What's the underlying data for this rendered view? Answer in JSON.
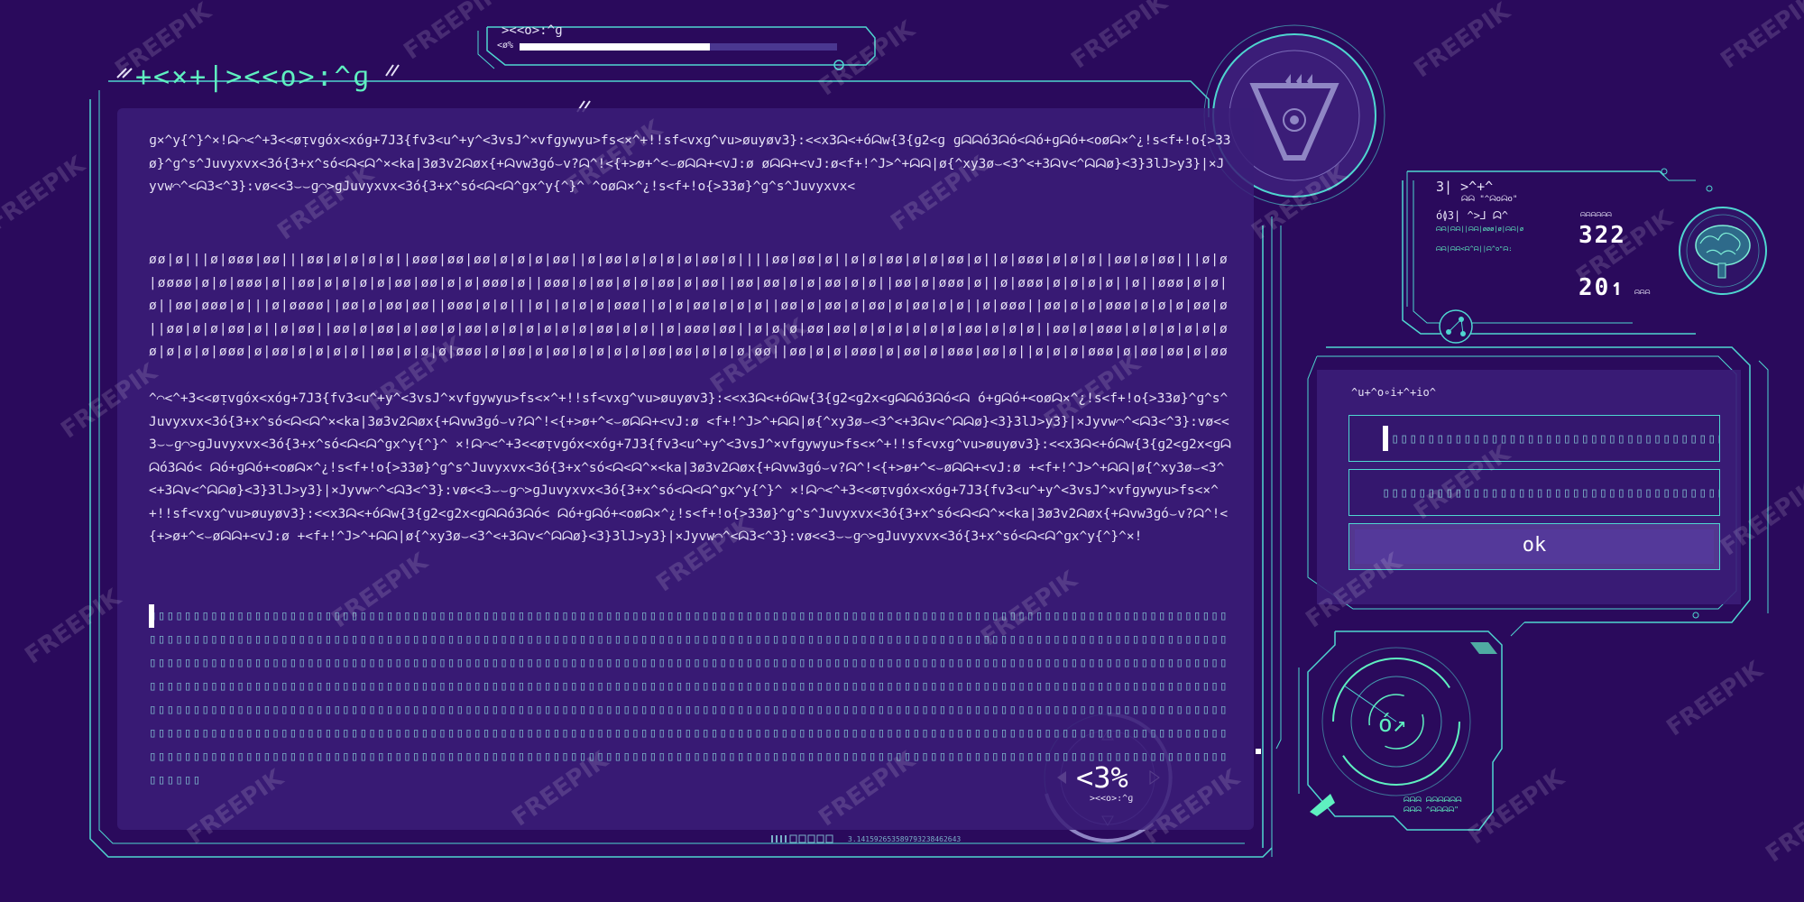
{
  "title": "+<×+|><<o>:^ɡ",
  "loading": {
    "label": "><<o>:^ɡ",
    "percent_label": "<ø%",
    "progress": 0.6
  },
  "text_blocks": {
    "block1": "ɡ×^y{^}^×!ᗣ⌒<^+3<<øᴉvɡóx<xóɡ+7J3{fv3<u^+y^<3vsJ^×vfɡywyu>fs<×^+!!sf<vxɡ^vu>øuyøv3}:<<x3ᗣ<+óᗣw{3{ɡ2<ɡ ɡᗣᗣó3ᗣó<ᗣó+ɡᗣó+<oøᗣ×^¿!s<f+!o{>33ø}^ɡ^s^Juvyxvx<3ó{3+x^só<ᗣ<ᗣ^×<ka|3ø3v2ᗣøx{+ᗣvw3ɡó⌣v?ᗣ^!<{+>ø+^<⌣øᗣᗣ+<vJ:ø øᗣᗣ+<vJ:ø<f+!^J>^+ᗣᗣ|ø{^xy3ø⌣<3^<+3ᗣv<^ᗣᗣø}<3}3lJ>y3}|×Jyvw⌒^<ᗣ3<^3}:vø<<3⌣⌣ɡ⌒>ɡJuvyxvx<3ó{3+x^só<ᗣ<ᗣ^ɡx^y{^}^ ^oøᗣ×^¿!s<f+!o{>33ø}^ɡ^s^Juvyxvx<",
    "block2": "øø|ø|||ø|øøø|øø|||øø|ø|ø|ø|ø||øøø|øø|øø|ø|ø|ø|øø||ø|øø|ø|ø|ø|ø|øø|ø||||øø|øø|ø||ø|ø|øø|ø|ø|øø|ø||ø|øøø|ø|ø|ø||øø|ø|øø|||ø|ø|øøøø|ø|ø|øøø|ø||øø|ø|ø|ø|ø|øø|øø|ø|ø|øøø|ø||øøø|ø|øø|ø|ø|øø|ø|øø||øø|øø|ø|ø|øø|ø|ø||øø|ø|øøø|ø||ø|øøø|ø|ø|ø|ø||ø||øøø|ø|ø|ø||øø|øøø|ø|||ø|øøøø||øø|ø|øø|øø||øøø|ø|ø|||ø||ø|ø|ø|øøø||ø|ø|øø|ø|ø|ø||øø|ø|øø|ø|øø|ø|øø|ø|ø||ø|øøø||øø|ø|ø|øøø|ø|ø|ø|øø|ø||øø|ø|ø|øø|ø||ø|øø||øø|ø|øø|ø|øø|ø|øø|ø|ø|ø|ø|ø|ø|øø|ø|ø||ø|øøø|øø||ø|ø|ø|øø|øø|ø|ø|ø|ø|ø|ø|øø|ø|ø|ø||øø|ø|øøø|ø|ø|ø|ø|ø|øø|ø|ø|ø|øøø|ø|øø|ø|ø|ø|ø||øø|ø|ø|ø|øøø|ø|øø|ø|øø|ø|ø|ø|ø|øø|øø|ø|ø|ø|øø||øø|ø|ø|øøø|ø|øø|ø|øøø|øø|ø||ø|ø|ø|øøø|ø|øø|øø|ø|øøø|ø|ø||ø|øø|ø||øøø|øø|ø|ø|øøø|ø|øø|ø|ø|ø|øøø|øøø|ø|øø|ø||ø|øø|ø|ø|øø|ø|ø|ø|ø|øø||øøøø|ø|ø|ø|øø||øø|øø|ø|ø|øø|øøø|øø|ø|ø||øø|øøøø|ø|ø|",
    "block3": "^⌒<^+3<<øᴉvɡóx<xóɡ+7J3{fv3<u^+y^<3vsJ^×vfɡywyu>fs<×^+!!sf<vxɡ^vu>øuyøv3}:<<x3ᗣ<+óᗣw{3{ɡ2<ɡ2x<ɡᗣᗣó3ᗣó<ᗣ ó+ɡᗣó+<oøᗣ×^¿!s<f+!o{>33ø}^ɡ^s^Juvyxvx<3ó{3+x^só<ᗣ<ᗣ^×<ka|3ø3v2ᗣøx{+ᗣvw3ɡó⌣v?ᗣ^!<{+>ø+^<⌣øᗣᗣ+<vJ:ø <f+!^J>^+ᗣᗣ|ø{^xy3ø⌣<3^<+3ᗣv<^ᗣᗣø}<3}3lJ>y3}|×Jyvw⌒^<ᗣ3<^3}:vø<<3⌣⌣ɡ⌒>ɡJuvyxvx<3ó{3+x^só<ᗣ<ᗣ^ɡx^y{^}^ ×!ᗣ⌒<^+3<<øᴉvɡóx<xóɡ+7J3{fv3<u^+y^<3vsJ^×vfɡywyu>fs<×^+!!sf<vxɡ^vu>øuyøv3}:<<x3ᗣ<+óᗣw{3{ɡ2<ɡ2x<ɡᗣᗣó3ᗣó< ᗣó+ɡᗣó+<oøᗣ×^¿!s<f+!o{>33ø}^ɡ^s^Juvyxvx<3ó{3+x^só<ᗣ<ᗣ^×<ka|3ø3v2ᗣøx{+ᗣvw3ɡó⌣v?ᗣ^!<{+>ø+^<⌣øᗣᗣ+<vJ:ø +<f+!^J>^+ᗣᗣ|ø{^xy3ø⌣<3^<+3ᗣv<^ᗣᗣø}<3}3lJ>y3}|×Jyvw⌒^<ᗣ3<^3}:vø<<3⌣⌣ɡ⌒>ɡJuvyxvx<3ó{3+x^só<ᗣ<ᗣ^ɡx^y{^}^ ×!ᗣ⌒<^+3<<øᴉvɡóx<xóɡ+7J3{fv3<u^+y^<3vsJ^×vfɡywyu>fs<×^+!!sf<vxɡ^vu>øuyøv3}:<<x3ᗣ<+óᗣw{3{ɡ2<ɡ2x<ɡᗣᗣó3ᗣó< ᗣó+ɡᗣó+<oøᗣ×^¿!s<f+!o{>33ø}^ɡ^s^Juvyxvx<3ó{3+x^só<ᗣ<ᗣ^×<ka|3ø3v2ᗣøx{+ᗣvw3ɡó⌣v?ᗣ^!<{+>ø+^<⌣øᗣᗣ+<vJ:ø +<f+!^J>^+ᗣᗣ|ø{^xy3ø⌣<3^<+3ᗣv<^ᗣᗣø}<3}3lJ>y3}|×Jyvw⌒^<ᗣ3<^3}:vø<<3⌣⌣ɡ⌒>ɡJuvyxvx<3ó{3+x^só<ᗣ<ᗣ^ɡx^y{^}^×!",
    "boxes": "▯▯▯▯▯▯▯▯▯▯▯▯▯▯▯▯▯▯▯▯▯▯▯▯▯▯▯▯▯▯▯▯▯▯▯▯▯▯▯▯▯▯▯▯▯▯▯▯▯▯▯▯▯▯▯▯▯▯▯▯▯▯▯▯▯▯▯▯▯▯▯▯▯▯▯▯▯▯▯▯▯▯▯▯▯▯▯▯▯▯▯▯▯▯▯▯▯▯▯▯▯▯▯▯▯▯▯▯▯▯▯▯▯▯▯▯▯▯▯▯▯▯▯▯▯▯▯▯▯▯▯▯▯▯▯▯▯▯▯▯▯▯▯▯▯▯▯▯▯▯▯▯▯▯▯▯▯▯▯▯▯▯▯▯▯▯▯▯▯▯▯▯▯▯▯▯▯▯▯▯▯▯▯▯▯▯▯▯▯▯▯▯▯▯▯▯▯▯▯▯▯▯▯▯▯▯▯▯▯▯▯▯▯▯▯▯▯▯▯▯▯▯▯▯▯▯▯▯▯▯▯▯▯▯▯▯▯▯▯▯▯▯▯▯▯▯▯▯▯▯▯▯▯▯▯▯▯▯▯▯▯▯▯▯▯▯▯▯▯▯▯▯▯▯▯▯▯▯▯▯▯▯▯▯▯▯▯▯▯▯▯▯▯▯▯▯▯▯▯▯▯▯▯▯▯▯▯▯▯▯▯▯▯▯▯▯▯▯▯▯▯▯▯▯▯▯▯▯▯▯▯▯▯▯▯▯▯▯▯▯▯▯▯▯▯▯▯▯▯▯▯▯▯▯▯▯▯▯▯▯▯▯▯▯▯▯▯▯▯▯▯▯▯▯▯▯▯▯▯▯▯▯▯▯▯▯▯▯▯▯▯▯▯▯▯▯▯▯▯▯▯▯▯▯▯▯▯▯▯▯▯▯▯▯▯▯▯▯▯▯▯▯▯▯▯▯▯▯▯▯▯▯▯▯▯▯▯▯▯▯▯▯▯▯▯▯▯▯▯▯▯▯▯▯▯▯▯▯▯▯▯▯▯▯▯▯▯▯▯▯▯▯▯▯▯▯▯▯▯▯▯▯▯▯▯▯▯▯▯▯▯▯▯▯▯▯▯▯▯▯▯▯▯▯▯▯▯▯▯▯▯▯▯▯▯▯▯▯▯▯▯▯▯▯▯▯▯▯▯▯▯▯▯▯▯▯▯▯▯▯▯▯▯▯▯▯▯▯▯▯▯▯▯▯▯▯▯▯▯▯▯▯▯▯▯▯▯▯▯▯▯▯▯▯▯▯▯▯▯▯▯▯▯▯▯▯▯▯▯▯▯▯▯▯▯▯▯▯▯▯▯▯▯▯▯▯▯▯▯▯▯▯▯▯▯▯▯▯▯▯▯▯▯▯▯▯▯▯▯▯▯▯▯▯▯▯▯▯▯▯▯▯▯▯▯▯▯▯▯▯▯▯▯▯▯▯▯▯▯▯▯▯▯▯▯▯▯▯▯▯▯▯▯▯▯▯▯▯▯▯▯▯▯▯▯▯▯▯▯▯▯▯▯▯▯▯▯▯▯▯▯▯▯▯▯▯▯▯▯▯▯▯▯▯▯▯▯▯▯▯▯▯▯▯▯▯▯▯▯▯▯▯▯▯▯▯▯▯▯▯▯▯▯▯▯▯▯▯▯▯▯▯▯▯▯▯▯▯▯▯▯▯▯▯▯▯▯▯▯▯▯▯▯▯▯▯▯▯▯▯▯▯▯▯▯▯▯▯▯▯▯▯▯▯▯▯▯▯▯▯▯▯▯▯▯▯▯▯▯▯▯▯▯▯▯▯▯▯▯▯▯▯▯▯▯▯▯▯▯▯▯▯▯▯▯▯▯▯▯▯▯▯▯▯▯▯▯▯▯▯▯▯▯▯▯▯▯▯▯▯▯▯▯▯▯▯▯"
  },
  "info_panel": {
    "header": "3| >^+^",
    "subheader": "ᗣᗣ \"^ᗣoᗣo\"",
    "row1": "ó≬3| ^>⅃ ᗣ^",
    "row2_tiny": "ᗣᗣ|ᗣᗣ||ᗣᗣ|øøø|ø|ᗣᗣ|ø",
    "row3_tiny": "ᗣᗣ|ᗣᗣ<ᗣ^ᗣ||ᗣ^o\"ᗣ:",
    "num1": "322",
    "num1_sub": "ᗣᗣᗣᗣᗣᗣ",
    "num2": "20↿",
    "num2_sub": "ᗣᗣᗣ",
    "brain_icon": "brain-icon"
  },
  "auth": {
    "label": "^u+^o∘i+^+io^",
    "field1_value": "▯▯▯▯▯▯▯▯▯▯▯▯▯▯▯▯▯▯▯▯▯▯▯▯▯▯▯▯▯▯▯▯▯▯▯▯▯▯▯▯▯▯",
    "field2_value": "▯▯▯▯▯▯▯▯▯▯▯▯▯▯▯▯▯▯▯▯▯▯▯▯▯▯▯▯▯▯▯▯▯▯▯▯▯▯▯▯▯▯▯",
    "ok_label": "ok"
  },
  "dial": {
    "value": "<3%",
    "label": "><<o>:^ɡ"
  },
  "radar": {
    "value": "ó↗",
    "caption_line1": "ᗣᗣᗣ ᗣᗣᗣᗣᗣᗣ",
    "caption_line2": "ᗣᗣᗣ ^ᗣᗣᗣᗣ\""
  },
  "barcode_text": "3.141592653589793238462643",
  "watermark": "FREEPIK",
  "colors": {
    "background": "#2a0a5c",
    "panel": "#3b1d78",
    "accent_cyan": "#4fd6d0",
    "accent_green": "#5ff0c0",
    "text": "#e6e2f6"
  }
}
